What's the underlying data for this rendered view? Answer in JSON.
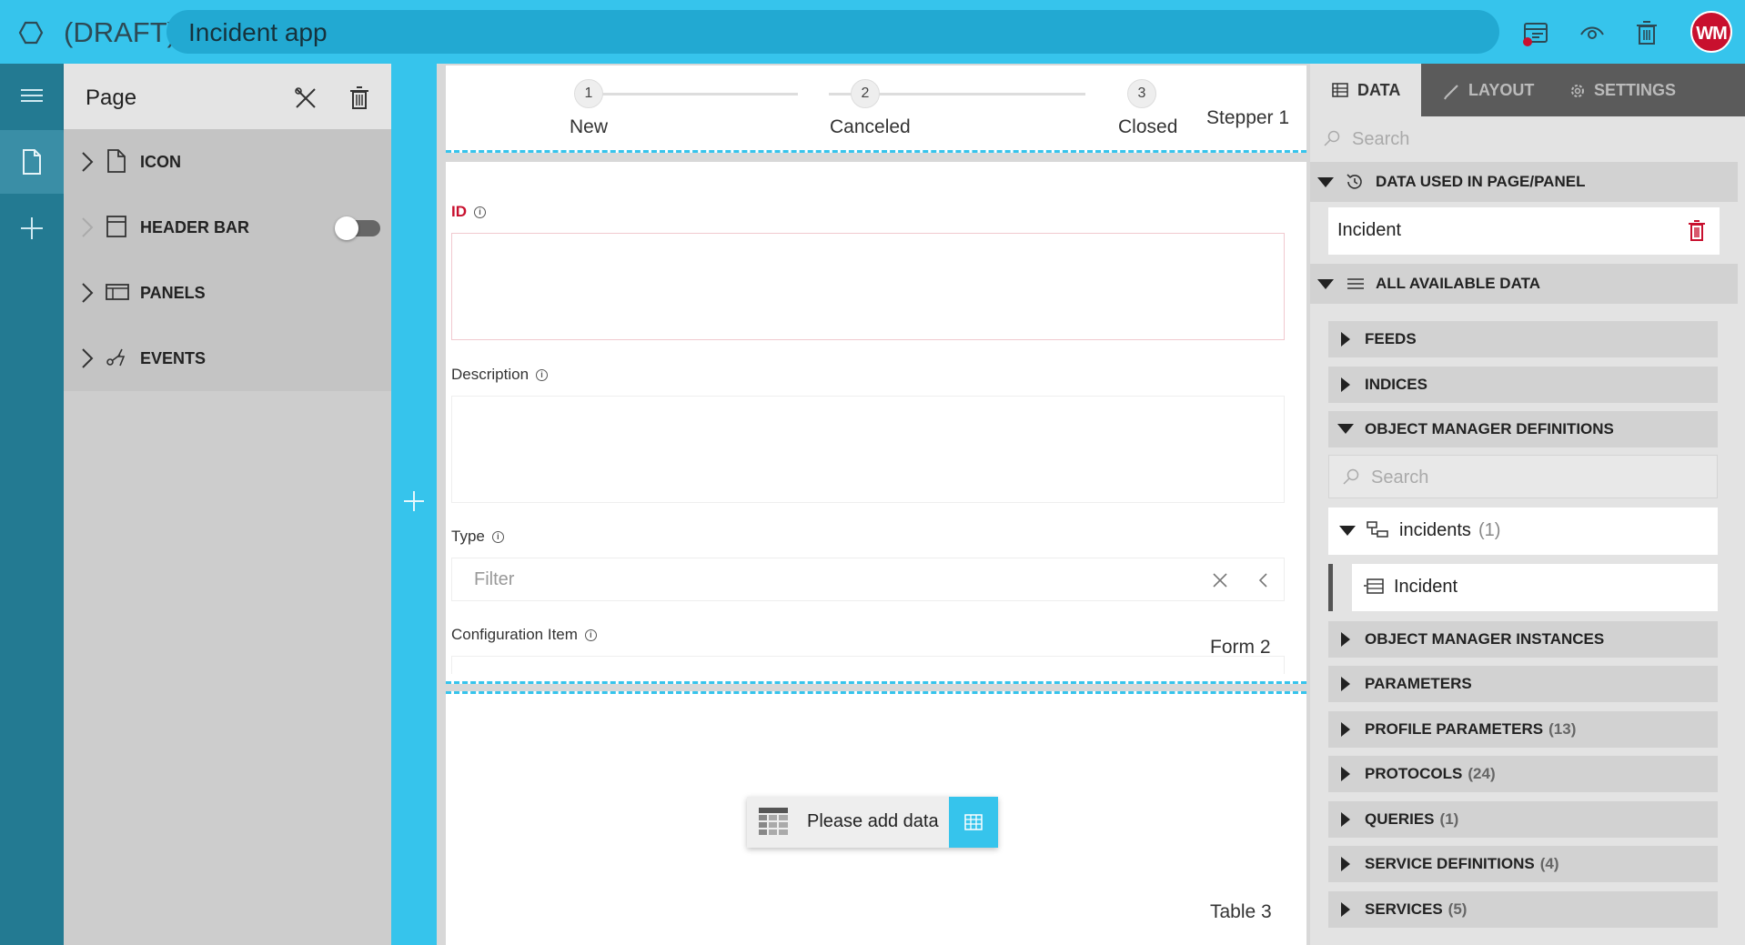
{
  "topbar": {
    "draft_label": "(DRAFT)",
    "app_title": "Incident app",
    "avatar_initials": "WM"
  },
  "page_panel": {
    "title": "Page",
    "items": [
      {
        "label": "ICON"
      },
      {
        "label": "HEADER BAR"
      },
      {
        "label": "PANELS"
      },
      {
        "label": "EVENTS"
      }
    ]
  },
  "stepper": {
    "tag": "Stepper 1",
    "steps": [
      {
        "number": "1",
        "label": "New"
      },
      {
        "number": "2",
        "label": "Canceled"
      },
      {
        "number": "3",
        "label": "Closed"
      }
    ]
  },
  "form": {
    "tag": "Form 2",
    "fields": {
      "id": {
        "label": "ID"
      },
      "description": {
        "label": "Description"
      },
      "type": {
        "label": "Type",
        "placeholder": "Filter"
      },
      "configuration_item": {
        "label": "Configuration Item"
      }
    }
  },
  "table": {
    "tag": "Table 3",
    "add_data_label": "Please add data"
  },
  "right_panel": {
    "tabs": [
      {
        "label": "DATA",
        "active": true
      },
      {
        "label": "LAYOUT",
        "active": false
      },
      {
        "label": "SETTINGS",
        "active": false
      }
    ],
    "search_placeholder": "Search",
    "used_section": {
      "label": "DATA USED IN PAGE/PANEL",
      "items": [
        {
          "label": "Incident"
        }
      ]
    },
    "available_section": {
      "label": "ALL AVAILABLE DATA",
      "groups_top": [
        {
          "label": "FEEDS",
          "count": ""
        },
        {
          "label": "INDICES",
          "count": ""
        }
      ],
      "object_manager_definitions": {
        "label": "OBJECT MANAGER DEFINITIONS",
        "search_placeholder": "Search",
        "tree": {
          "label": "incidents",
          "count": "(1)",
          "child": "Incident"
        }
      },
      "groups_bottom": [
        {
          "label": "OBJECT MANAGER INSTANCES",
          "count": ""
        },
        {
          "label": "PARAMETERS",
          "count": ""
        },
        {
          "label": "PROFILE PARAMETERS",
          "count": "(13)"
        },
        {
          "label": "PROTOCOLS",
          "count": "(24)"
        },
        {
          "label": "QUERIES",
          "count": "(1)"
        },
        {
          "label": "SERVICE DEFINITIONS",
          "count": "(4)"
        },
        {
          "label": "SERVICES",
          "count": "(5)"
        }
      ]
    }
  },
  "colors": {
    "accent": "#36c4ec",
    "rail": "#237a92",
    "danger": "#c8102e"
  }
}
